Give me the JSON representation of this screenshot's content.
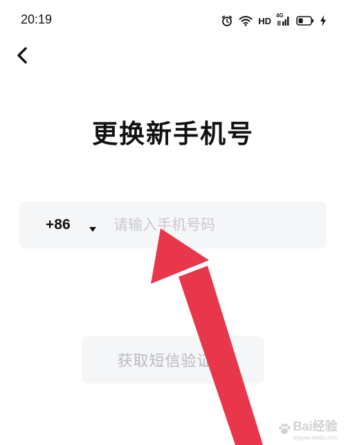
{
  "status_bar": {
    "time": "20:19",
    "hd_label": "HD",
    "network_label": "4G",
    "icons": [
      "alarm-icon",
      "wifi-icon",
      "signal-icon",
      "battery-icon",
      "charging-icon"
    ]
  },
  "header": {
    "back_icon": "chevron-left-icon"
  },
  "page": {
    "title": "更换新手机号"
  },
  "phone_form": {
    "country_code": "+86",
    "dropdown_icon": "triangle-down-icon",
    "phone_placeholder": "请输入手机号码",
    "phone_value": ""
  },
  "actions": {
    "get_code_label": "获取短信验证码"
  },
  "annotation": {
    "arrow_color": "#e8364a"
  },
  "watermark": {
    "text": "Bai经验",
    "sub": "jingyan.baidu.com"
  },
  "colors": {
    "input_background": "#f5f6f8",
    "placeholder": "#c8c9cc",
    "disabled_button_text": "#b9babd",
    "arrow": "#e8364a"
  }
}
